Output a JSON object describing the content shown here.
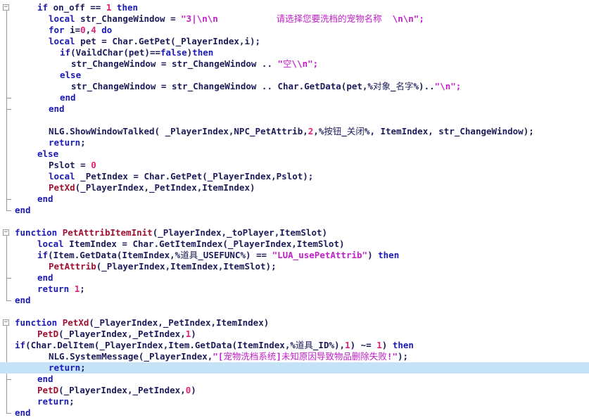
{
  "editor": {
    "lines": [
      [
        {
          "t": "if",
          "c": "kw"
        },
        {
          "t": " on_off == ",
          "c": "id"
        },
        {
          "t": "1",
          "c": "num"
        },
        {
          "t": " then",
          "c": "kw"
        }
      ],
      [
        {
          "t": "local",
          "c": "kw"
        },
        {
          "t": " str_ChangeWindow = ",
          "c": "id"
        },
        {
          "t": "\"3|\\n\\n           请选择您要洗档的宠物名称  \\n\\n\";",
          "c": "str"
        }
      ],
      [
        {
          "t": "for",
          "c": "kw"
        },
        {
          "t": " i=",
          "c": "id"
        },
        {
          "t": "0",
          "c": "num"
        },
        {
          "t": ",",
          "c": "id"
        },
        {
          "t": "4",
          "c": "num"
        },
        {
          "t": " do",
          "c": "kw"
        }
      ],
      [
        {
          "t": "local",
          "c": "kw"
        },
        {
          "t": " pet = Char.GetPet(_PlayerIndex,i);",
          "c": "id"
        }
      ],
      [
        {
          "t": "if",
          "c": "kw"
        },
        {
          "t": "(VaildChar(pet)==",
          "c": "id"
        },
        {
          "t": "false",
          "c": "kw"
        },
        {
          "t": ")",
          "c": "id"
        },
        {
          "t": "then",
          "c": "kw"
        }
      ],
      [
        {
          "t": "str_ChangeWindow = str_ChangeWindow .. ",
          "c": "id"
        },
        {
          "t": "\"空\\\\n\";",
          "c": "str"
        }
      ],
      [
        {
          "t": "else",
          "c": "kw"
        }
      ],
      [
        {
          "t": "str_ChangeWindow = str_ChangeWindow .. Char.GetData(pet,%对象_名字%)..",
          "c": "id"
        },
        {
          "t": "\"\\n\";",
          "c": "str"
        }
      ],
      [
        {
          "t": "end",
          "c": "kw"
        }
      ],
      [
        {
          "t": "end",
          "c": "kw"
        }
      ],
      [],
      [
        {
          "t": "NLG.ShowWindowTalked( _PlayerIndex,NPC_PetAttrib,",
          "c": "id"
        },
        {
          "t": "2",
          "c": "num"
        },
        {
          "t": ",%按钮_关闭%, ItemIndex, str_ChangeWindow);",
          "c": "id"
        }
      ],
      [
        {
          "t": "return",
          "c": "kw"
        },
        {
          "t": ";",
          "c": "id"
        }
      ],
      [
        {
          "t": "else",
          "c": "kw"
        }
      ],
      [
        {
          "t": "Pslot = ",
          "c": "id"
        },
        {
          "t": "0",
          "c": "num"
        }
      ],
      [
        {
          "t": "local",
          "c": "kw"
        },
        {
          "t": " _PetIndex = Char.GetPet(_PlayerIndex,Pslot);",
          "c": "id"
        }
      ],
      [
        {
          "t": "PetXd",
          "c": "fn"
        },
        {
          "t": "(_PlayerIndex,_PetIndex,ItemIndex)",
          "c": "id"
        }
      ],
      [
        {
          "t": "end",
          "c": "kw"
        }
      ],
      [
        {
          "t": "end",
          "c": "kw"
        }
      ],
      [],
      [
        {
          "t": "function",
          "c": "kw"
        },
        {
          "t": " ",
          "c": "id"
        },
        {
          "t": "PetAttribItemInit",
          "c": "fn"
        },
        {
          "t": "(_PlayerIndex,_toPlayer,ItemSlot)",
          "c": "id"
        }
      ],
      [
        {
          "t": "local",
          "c": "kw"
        },
        {
          "t": " ItemIndex = Char.GetItemIndex(_PlayerIndex,ItemSlot)",
          "c": "id"
        }
      ],
      [
        {
          "t": "if",
          "c": "kw"
        },
        {
          "t": "(Item.GetData(ItemIndex,%道具_USEFUNC%) == ",
          "c": "id"
        },
        {
          "t": "\"LUA_usePetAttrib\"",
          "c": "str"
        },
        {
          "t": ") ",
          "c": "id"
        },
        {
          "t": "then",
          "c": "kw"
        }
      ],
      [
        {
          "t": "PetAttrib",
          "c": "fn"
        },
        {
          "t": "(_PlayerIndex,ItemIndex,ItemSlot);",
          "c": "id"
        }
      ],
      [
        {
          "t": "end",
          "c": "kw"
        }
      ],
      [
        {
          "t": "return",
          "c": "kw"
        },
        {
          "t": " ",
          "c": "id"
        },
        {
          "t": "1",
          "c": "num"
        },
        {
          "t": ";",
          "c": "id"
        }
      ],
      [
        {
          "t": "end",
          "c": "kw"
        }
      ],
      [],
      [
        {
          "t": "function",
          "c": "kw"
        },
        {
          "t": " ",
          "c": "id"
        },
        {
          "t": "PetXd",
          "c": "fn"
        },
        {
          "t": "(_PlayerIndex,_PetIndex,ItemIndex)",
          "c": "id"
        }
      ],
      [
        {
          "t": "PetD",
          "c": "fn"
        },
        {
          "t": "(_PlayerIndex,_PetIndex,",
          "c": "id"
        },
        {
          "t": "1",
          "c": "num"
        },
        {
          "t": ")",
          "c": "id"
        }
      ],
      [
        {
          "t": "if",
          "c": "kw"
        },
        {
          "t": "(Char.DelItem(_PlayerIndex,Item.GetData(ItemIndex,%道具_ID%),",
          "c": "id"
        },
        {
          "t": "1",
          "c": "num"
        },
        {
          "t": ") ~= ",
          "c": "id"
        },
        {
          "t": "1",
          "c": "num"
        },
        {
          "t": ") ",
          "c": "id"
        },
        {
          "t": "then",
          "c": "kw"
        }
      ],
      [
        {
          "t": "NLG.SystemMessage(_PlayerIndex,",
          "c": "id"
        },
        {
          "t": "\"[宠物洗档系统]未知原因导致物品删除失败!\"",
          "c": "str"
        },
        {
          "t": ");",
          "c": "id"
        }
      ],
      [
        {
          "t": "return",
          "c": "kw"
        },
        {
          "t": ";",
          "c": "id"
        }
      ],
      [
        {
          "t": "end",
          "c": "kw"
        }
      ],
      [
        {
          "t": "PetD",
          "c": "fn"
        },
        {
          "t": "(_PlayerIndex,_PetIndex,",
          "c": "id"
        },
        {
          "t": "0",
          "c": "num"
        },
        {
          "t": ")",
          "c": "id"
        }
      ],
      [
        {
          "t": "return",
          "c": "kw"
        },
        {
          "t": ";",
          "c": "id"
        }
      ],
      [
        {
          "t": "end",
          "c": "kw"
        }
      ]
    ],
    "indent": [
      2,
      3,
      3,
      3,
      4,
      5,
      4,
      5,
      4,
      3,
      0,
      3,
      3,
      2,
      3,
      3,
      3,
      2,
      0,
      0,
      0,
      2,
      2,
      3,
      2,
      2,
      0,
      0,
      0,
      2,
      0,
      3,
      3,
      2,
      2,
      2,
      0
    ],
    "highlighted_line": 32
  }
}
